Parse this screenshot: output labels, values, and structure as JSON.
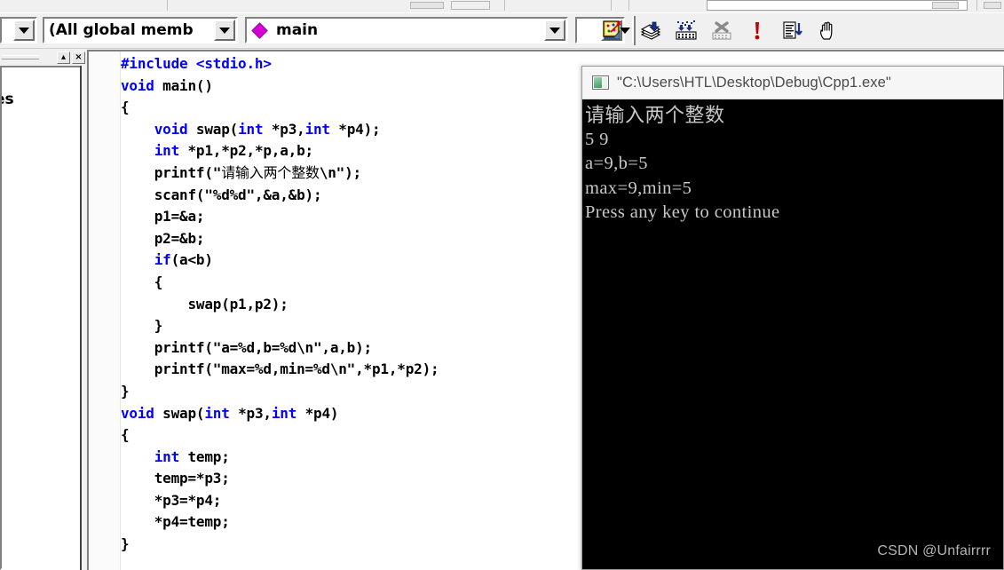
{
  "toolbar": {
    "members_combo_value": "(All global members",
    "members_combo_placeholder": "(All global members",
    "function_combo_value": "main",
    "function_combo_placeholder": "main",
    "blank_combo_value": "",
    "blank_combo_placeholder": "",
    "icons": [
      {
        "name": "compile-icon",
        "label": "Compile"
      },
      {
        "name": "build-icon",
        "label": "Build"
      },
      {
        "name": "stop-build-icon",
        "label": "Stop Build"
      },
      {
        "name": "execute-program-icon",
        "label": "Execute Program"
      },
      {
        "name": "go-icon",
        "label": "Go"
      },
      {
        "name": "insert-remove-breakpoint-icon",
        "label": "Insert/Remove Breakpoint"
      }
    ],
    "bookmark_icon_label": "Edit Bookmarks"
  },
  "left_panel": {
    "tab_label": "es",
    "minimize_label": "▴",
    "close_label": "×"
  },
  "editor": {
    "lines": [
      [
        {
          "t": "#include <stdio.h>",
          "c": "kw"
        }
      ],
      [
        {
          "t": "void",
          "c": "kw"
        },
        {
          "t": " main()",
          "c": ""
        }
      ],
      [
        {
          "t": "{",
          "c": ""
        }
      ],
      [
        {
          "t": "    ",
          "c": ""
        },
        {
          "t": "void",
          "c": "kw"
        },
        {
          "t": " swap(",
          "c": ""
        },
        {
          "t": "int",
          "c": "kw"
        },
        {
          "t": " *p3,",
          "c": ""
        },
        {
          "t": "int",
          "c": "kw"
        },
        {
          "t": " *p4);",
          "c": ""
        }
      ],
      [
        {
          "t": "    ",
          "c": ""
        },
        {
          "t": "int",
          "c": "kw"
        },
        {
          "t": " *p1,*p2,*p,a,b;",
          "c": ""
        }
      ],
      [
        {
          "t": "    printf(\"",
          "c": ""
        },
        {
          "t": "请输入两个整数",
          "c": "cjk"
        },
        {
          "t": "\\n\");",
          "c": ""
        }
      ],
      [
        {
          "t": "    scanf(\"%d%d\",&a,&b);",
          "c": ""
        }
      ],
      [
        {
          "t": "    p1=&a;",
          "c": ""
        }
      ],
      [
        {
          "t": "    p2=&b;",
          "c": ""
        }
      ],
      [
        {
          "t": "    ",
          "c": ""
        },
        {
          "t": "if",
          "c": "kw"
        },
        {
          "t": "(a<b)",
          "c": ""
        }
      ],
      [
        {
          "t": "    {",
          "c": ""
        }
      ],
      [
        {
          "t": "        swap(p1,p2);",
          "c": ""
        }
      ],
      [
        {
          "t": "    }",
          "c": ""
        }
      ],
      [
        {
          "t": "    printf(\"a=%d,b=%d\\n\",a,b);",
          "c": ""
        }
      ],
      [
        {
          "t": "    printf(\"max=%d,min=%d\\n\",*p1,*p2);",
          "c": ""
        }
      ],
      [
        {
          "t": "}",
          "c": ""
        }
      ],
      [
        {
          "t": "void",
          "c": "kw"
        },
        {
          "t": " swap(",
          "c": ""
        },
        {
          "t": "int",
          "c": "kw"
        },
        {
          "t": " *p3,",
          "c": ""
        },
        {
          "t": "int",
          "c": "kw"
        },
        {
          "t": " *p4)",
          "c": ""
        }
      ],
      [
        {
          "t": "{",
          "c": ""
        }
      ],
      [
        {
          "t": "    ",
          "c": ""
        },
        {
          "t": "int",
          "c": "kw"
        },
        {
          "t": " temp;",
          "c": ""
        }
      ],
      [
        {
          "t": "    temp=*p3;",
          "c": ""
        }
      ],
      [
        {
          "t": "    *p3=*p4;",
          "c": ""
        }
      ],
      [
        {
          "t": "    *p4=temp;",
          "c": ""
        }
      ],
      [
        {
          "t": "}",
          "c": ""
        }
      ]
    ]
  },
  "console": {
    "title": "\"C:\\Users\\HTL\\Desktop\\Debug\\Cpp1.exe\"",
    "lines": [
      {
        "text": "请输入两个整数",
        "cjk": true
      },
      {
        "text": "5 9",
        "cjk": false
      },
      {
        "text": "a=9,b=5",
        "cjk": false
      },
      {
        "text": "max=9,min=5",
        "cjk": false
      },
      {
        "text": "Press any key to continue",
        "cjk": false
      }
    ]
  },
  "watermark": {
    "text": "CSDN @Unfairrrr"
  },
  "colors": {
    "keyword": "#0000ff",
    "code_text": "#000000",
    "console_bg": "#000000",
    "console_text": "#c8c8c8",
    "chrome_bg": "#f0f0f0",
    "diamond_accent": "#d600d6"
  }
}
